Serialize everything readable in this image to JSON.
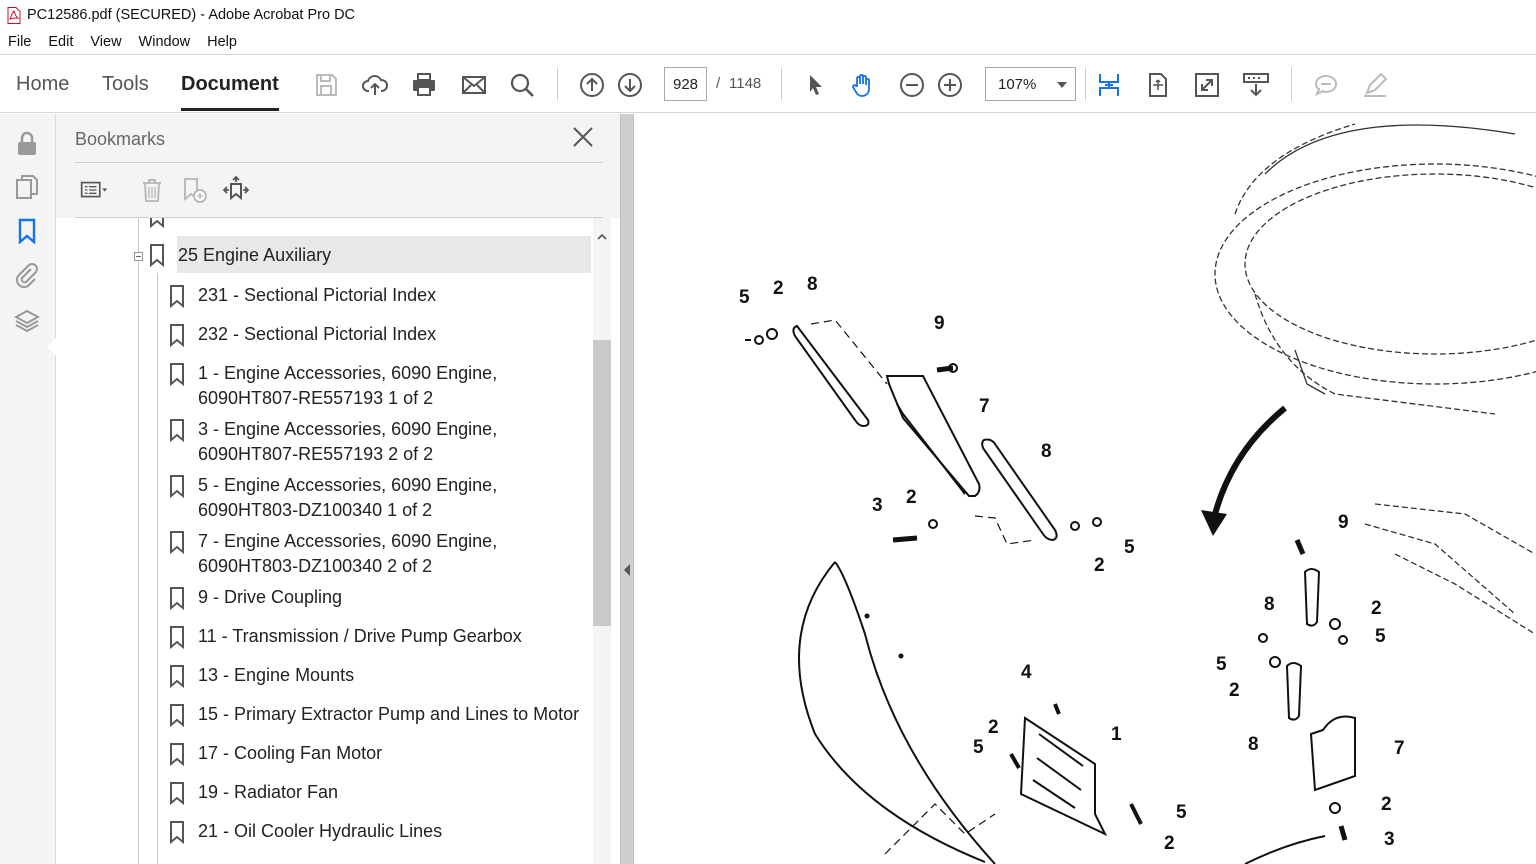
{
  "window": {
    "title": "PC12586.pdf (SECURED) - Adobe Acrobat Pro DC"
  },
  "menu": [
    "File",
    "Edit",
    "View",
    "Window",
    "Help"
  ],
  "nav_tabs": {
    "home": "Home",
    "tools": "Tools",
    "document": "Document"
  },
  "page_nav": {
    "current": "928",
    "separator": "/",
    "total": "1148"
  },
  "zoom": {
    "value": "107%"
  },
  "bookmarks": {
    "title": "Bookmarks",
    "parent": {
      "label": "25 Engine Auxiliary"
    },
    "items": [
      {
        "line1": "231 - Sectional Pictorial Index",
        "line2": ""
      },
      {
        "line1": "232 - Sectional Pictorial Index",
        "line2": ""
      },
      {
        "line1": "1 - Engine Accessories, 6090 Engine,",
        "line2": "6090HT807-RE557193 1 of 2"
      },
      {
        "line1": "3 - Engine Accessories, 6090 Engine,",
        "line2": "6090HT807-RE557193 2 of 2"
      },
      {
        "line1": "5 - Engine Accessories, 6090 Engine,",
        "line2": "6090HT803-DZ100340 1 of 2"
      },
      {
        "line1": "7 - Engine Accessories, 6090 Engine,",
        "line2": "6090HT803-DZ100340 2 of 2"
      },
      {
        "line1": "9 - Drive Coupling",
        "line2": ""
      },
      {
        "line1": "11 - Transmission / Drive Pump Gearbox",
        "line2": ""
      },
      {
        "line1": "13 - Engine Mounts",
        "line2": ""
      },
      {
        "line1": "15 - Primary Extractor Pump and Lines to Motor",
        "line2": ""
      },
      {
        "line1": "17 - Cooling Fan Motor",
        "line2": ""
      },
      {
        "line1": "19 - Radiator Fan",
        "line2": ""
      },
      {
        "line1": "21 - Oil Cooler Hydraulic Lines",
        "line2": ""
      }
    ]
  },
  "drawing": {
    "callouts": [
      "5",
      "2",
      "8",
      "9",
      "7",
      "8",
      "3",
      "2",
      "2",
      "5",
      "9",
      "8",
      "2",
      "5",
      "5",
      "2",
      "4",
      "2",
      "5",
      "1",
      "8",
      "7",
      "5",
      "2",
      "2",
      "3"
    ]
  },
  "icons": [
    "pdf-file-icon",
    "save-icon",
    "upload-icon",
    "print-icon",
    "email-icon",
    "search-icon",
    "prev-page-icon",
    "next-page-icon",
    "select-tool-icon",
    "hand-tool-icon",
    "zoom-out-icon",
    "zoom-in-icon",
    "fit-page-icon",
    "rotate-icon",
    "fullscreen-icon",
    "scroll-mode-icon",
    "comment-icon",
    "highlight-icon",
    "lock-icon",
    "pages-icon",
    "bookmark-icon",
    "attachment-icon",
    "layers-icon",
    "close-icon"
  ]
}
